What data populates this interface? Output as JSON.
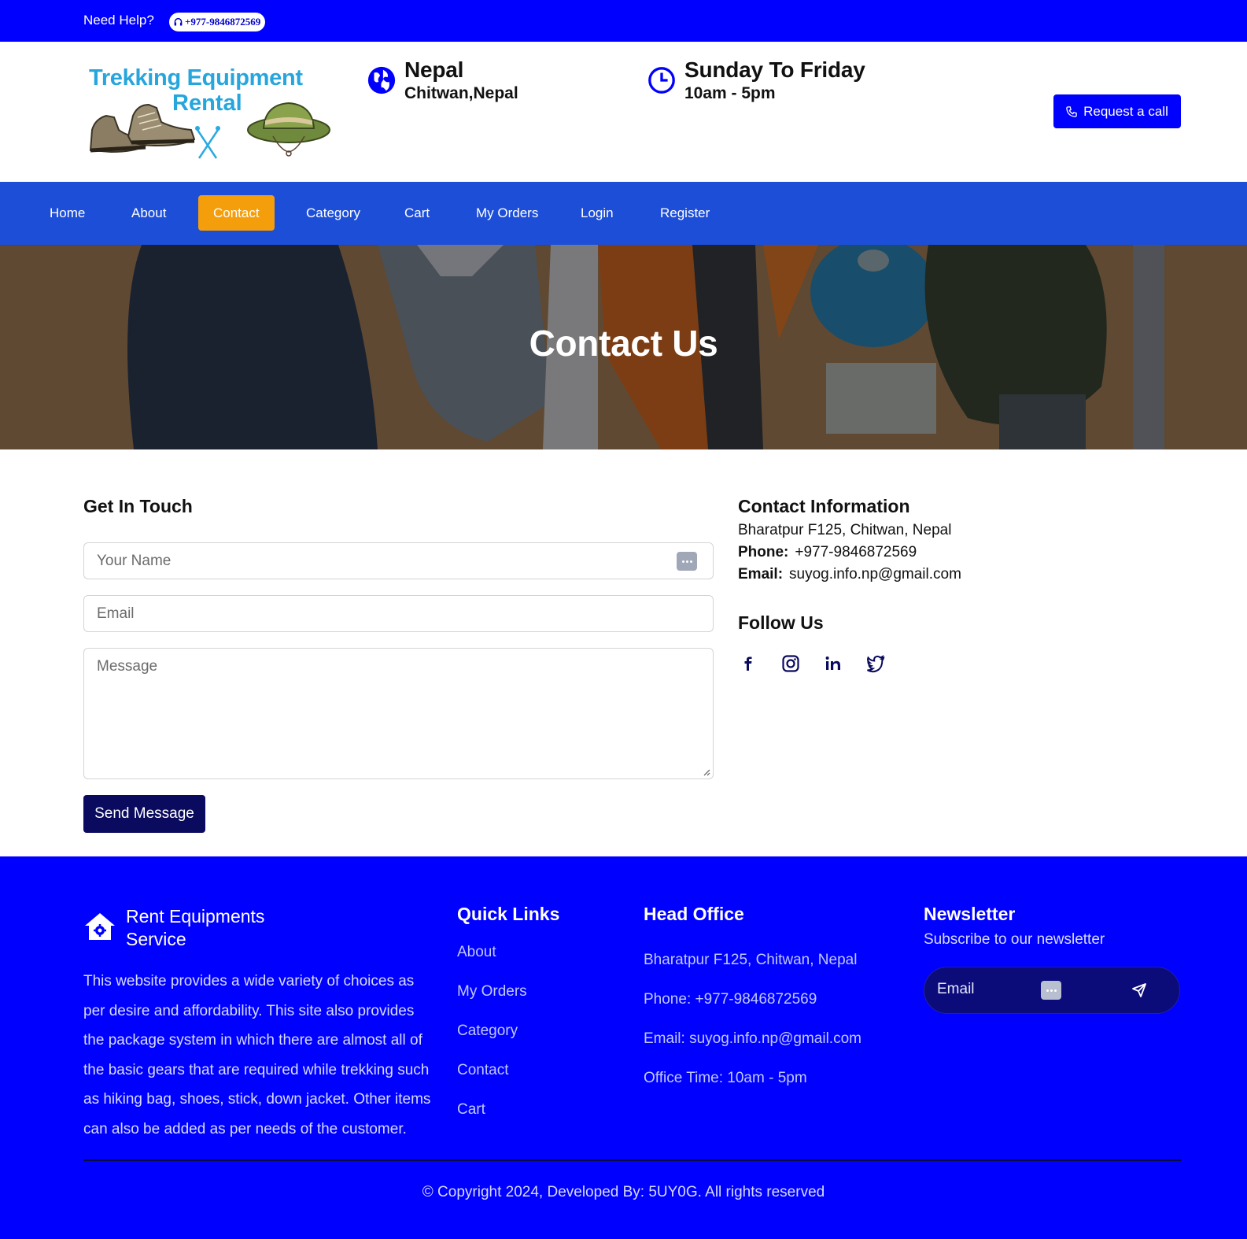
{
  "topbar": {
    "help_text": "Need Help?",
    "phone": "+977-9846872569"
  },
  "header": {
    "logo_line1": "Trekking Equipment",
    "logo_line2": "Rental",
    "location_title": "Nepal",
    "location_sub": "Chitwan,Nepal",
    "hours_title": "Sunday To Friday",
    "hours_sub": "10am - 5pm",
    "request_button": "Request a call"
  },
  "nav": {
    "items": [
      {
        "label": "Home",
        "active": false
      },
      {
        "label": "About",
        "active": false
      },
      {
        "label": "Contact",
        "active": true
      },
      {
        "label": "Category",
        "active": false
      },
      {
        "label": "Cart",
        "active": false
      },
      {
        "label": "My Orders",
        "active": false
      },
      {
        "label": "Login",
        "active": false
      },
      {
        "label": "Register",
        "active": false
      }
    ]
  },
  "hero": {
    "title": "Contact Us"
  },
  "form": {
    "heading": "Get In Touch",
    "name_placeholder": "Your Name",
    "email_placeholder": "Email",
    "message_placeholder": "Message",
    "submit_label": "Send Message"
  },
  "contact_info": {
    "heading": "Contact Information",
    "address": "Bharatpur F125, Chitwan, Nepal",
    "phone_label": "Phone:",
    "phone": "+977-9846872569",
    "email_label": "Email:",
    "email": "suyog.info.np@gmail.com",
    "follow_heading": "Follow Us",
    "socials": [
      "facebook-icon",
      "instagram-icon",
      "linkedin-icon",
      "twitter-icon"
    ]
  },
  "footer": {
    "brand_line1": "Rent Equipments",
    "brand_line2": "Service",
    "description": "This website provides a wide variety of choices as per desire and affordability. This site also provides the package system in which there are almost all of the basic gears that are required while trekking such as hiking bag, shoes, stick, down jacket. Other items can also be added as per needs of the customer.",
    "quick_links_heading": "Quick Links",
    "quick_links": [
      "About",
      "My Orders",
      "Category",
      "Contact",
      "Cart"
    ],
    "head_office_heading": "Head Office",
    "head_office": [
      "Bharatpur F125, Chitwan, Nepal",
      "Phone: +977-9846872569",
      "Email: suyog.info.np@gmail.com",
      "Office Time: 10am - 5pm"
    ],
    "newsletter_heading": "Newsletter",
    "newsletter_sub": "Subscribe to our newsletter",
    "newsletter_placeholder": "Email",
    "copyright": "© Copyright 2024, Developed By: 5UY0G. All rights reserved"
  },
  "colors": {
    "primary_blue": "#0000ff",
    "nav_blue": "#1d4ed8",
    "active_orange": "#f59e0b",
    "dark_navy": "#0a0a5e",
    "logo_cyan": "#26a6dc"
  }
}
